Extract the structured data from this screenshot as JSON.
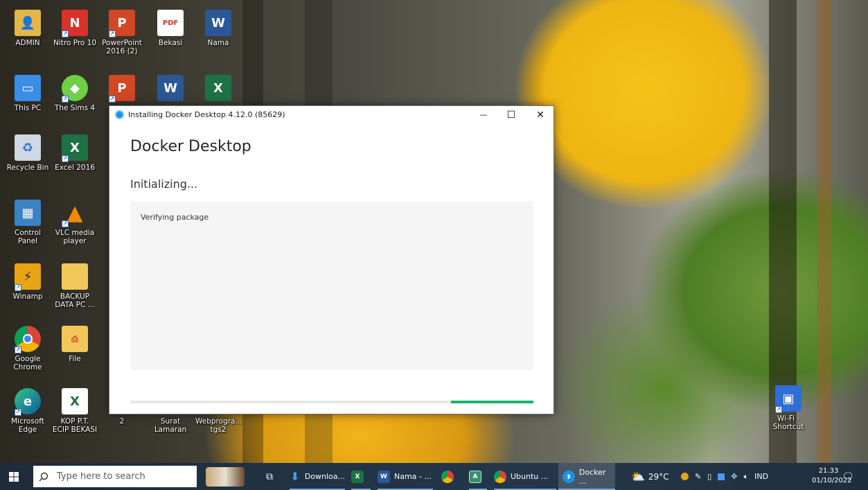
{
  "desktop": {
    "icons": [
      {
        "label": "ADMIN"
      },
      {
        "label": "Nitro Pro 10"
      },
      {
        "label": "PowerPoint 2016 (2)"
      },
      {
        "label": "Bekasi"
      },
      {
        "label": "Nama"
      },
      {
        "label": "This PC"
      },
      {
        "label": "The Sims 4"
      },
      {
        "label": "Recycle Bin"
      },
      {
        "label": "Excel 2016"
      },
      {
        "label": "Control Panel"
      },
      {
        "label": "VLC media player"
      },
      {
        "label": "Winamp"
      },
      {
        "label": "BACKUP DATA PC ..."
      },
      {
        "label": "Google Chrome"
      },
      {
        "label": "File"
      },
      {
        "label": "Microsoft Edge"
      },
      {
        "label": "KOP P.T. ECIP BEKASI"
      },
      {
        "label": "2"
      },
      {
        "label": "Surat Lamaran"
      },
      {
        "label": "Webprogra... tgs2"
      },
      {
        "label": "Wi-Fi - Shortcut"
      }
    ]
  },
  "installer": {
    "window_title": "Installing Docker Desktop 4.12.0 (85629)",
    "minimize_glyph": "—",
    "maximize_glyph": "☐",
    "close_glyph": "✕",
    "heading": "Docker Desktop",
    "status": "Initializing...",
    "log_line": "Verifying package",
    "progress_indicator": "indeterminate"
  },
  "taskbar": {
    "search_placeholder": "Type here to search",
    "items": [
      {
        "label": "Downloa...",
        "icon": "download-icon"
      },
      {
        "label": "",
        "icon": "excel-icon"
      },
      {
        "label": "Nama - ...",
        "icon": "word-icon"
      },
      {
        "label": "",
        "icon": "chrome-icon"
      },
      {
        "label": "",
        "icon": "app-icon"
      },
      {
        "label": "Ubuntu ...",
        "icon": "chrome-ubuntu-icon"
      },
      {
        "label": "Docker ...",
        "icon": "docker-icon"
      }
    ],
    "weather": "29°C",
    "language": "IND",
    "time": "21.33",
    "date": "01/10/2022"
  }
}
